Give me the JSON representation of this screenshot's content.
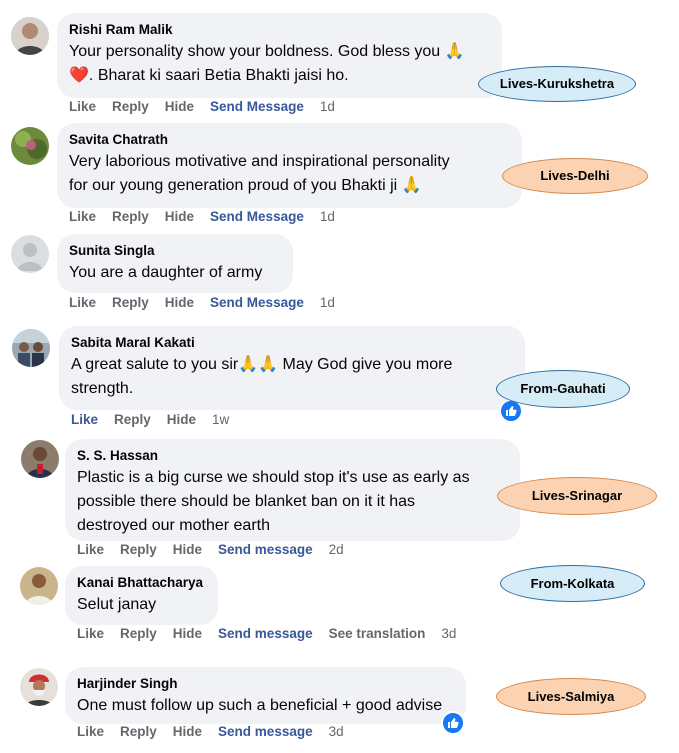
{
  "comments": [
    {
      "name": "Rishi Ram Malik",
      "lines": [
        "Your personality show your boldness. God bless you 🙏",
        "❤️. Bharat ki saari Betia Bhakti jaisi ho."
      ],
      "actions": [
        "Like",
        "Reply",
        "Hide",
        "Send Message"
      ],
      "time": "1d",
      "location": "Lives-Kurukshetra"
    },
    {
      "name": "Savita Chatrath",
      "lines": [
        "Very laborious motivative and inspirational personality",
        "for our young generation proud of you Bhakti ji 🙏"
      ],
      "actions": [
        "Like",
        "Reply",
        "Hide",
        "Send Message"
      ],
      "time": "1d",
      "location": "Lives-Delhi"
    },
    {
      "name": "Sunita Singla",
      "lines": [
        "You are a daughter of army"
      ],
      "actions": [
        "Like",
        "Reply",
        "Hide",
        "Send Message"
      ],
      "time": "1d"
    },
    {
      "name": "Sabita Maral Kakati",
      "lines": [
        "A great salute to you sir🙏🙏 May God give you more",
        "strength."
      ],
      "actions": [
        "Like",
        "Reply",
        "Hide"
      ],
      "time": "1w",
      "location": "From-Gauhati"
    },
    {
      "name": "S. S. Hassan",
      "lines": [
        "Plastic is a big curse we should stop it's use as early as",
        "possible there should be blanket ban on it it has",
        "destroyed our mother earth"
      ],
      "actions": [
        "Like",
        "Reply",
        "Hide",
        "Send message"
      ],
      "time": "2d",
      "location": "Lives-Srinagar"
    },
    {
      "name": "Kanai Bhattacharya",
      "lines": [
        "Selut janay"
      ],
      "actions": [
        "Like",
        "Reply",
        "Hide",
        "Send message",
        "See translation"
      ],
      "time": "3d",
      "location": "From-Kolkata"
    },
    {
      "name": "Harjinder Singh",
      "lines": [
        "One must follow up such a beneficial + good advise"
      ],
      "actions": [
        "Like",
        "Reply",
        "Hide",
        "Send message"
      ],
      "time": "3d",
      "location": "Lives-Salmiya"
    }
  ],
  "icons": {
    "like_reaction": "thumbs-up-icon"
  },
  "colors": {
    "bubble": "#f0f2f5",
    "link_blue": "#385898",
    "action_gray": "#65676b",
    "like_blue": "#1877f2"
  }
}
